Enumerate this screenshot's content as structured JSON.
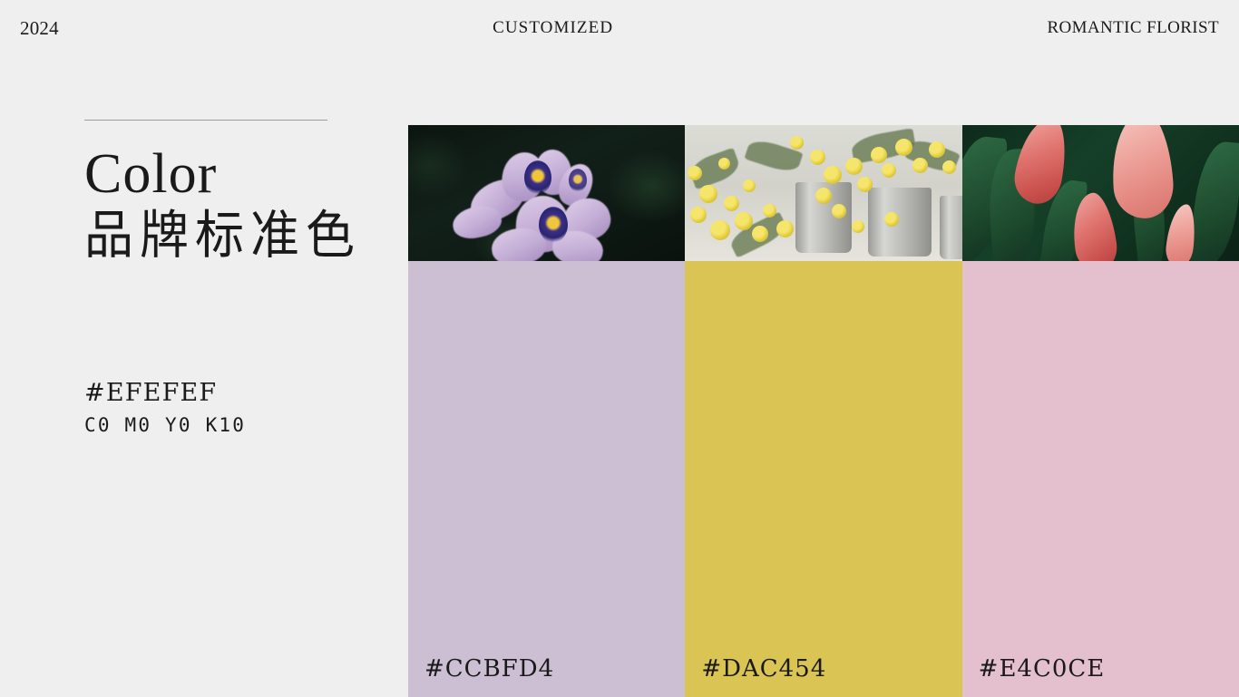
{
  "header": {
    "year": "2024",
    "center": "CUSTOMIZED",
    "right": "ROMANTIC FLORIST"
  },
  "left": {
    "title_en": "Color",
    "title_cn": "品牌标准色",
    "base_hex": "#EFEFEF",
    "base_cmyk": "C0 M0 Y0 K10"
  },
  "palette": {
    "swatches": [
      {
        "hex_label": "#CCBFD4",
        "color": "#ccbfd4",
        "photo_name": "purple-water-hyacinth-photo"
      },
      {
        "hex_label": "#DAC454",
        "color": "#dac454",
        "photo_name": "yellow-mimosa-buckets-photo"
      },
      {
        "hex_label": "#E4C0CE",
        "color": "#e4c0ce",
        "photo_name": "pink-calla-lily-photo"
      }
    ]
  },
  "page": {
    "background": "#efefef"
  }
}
